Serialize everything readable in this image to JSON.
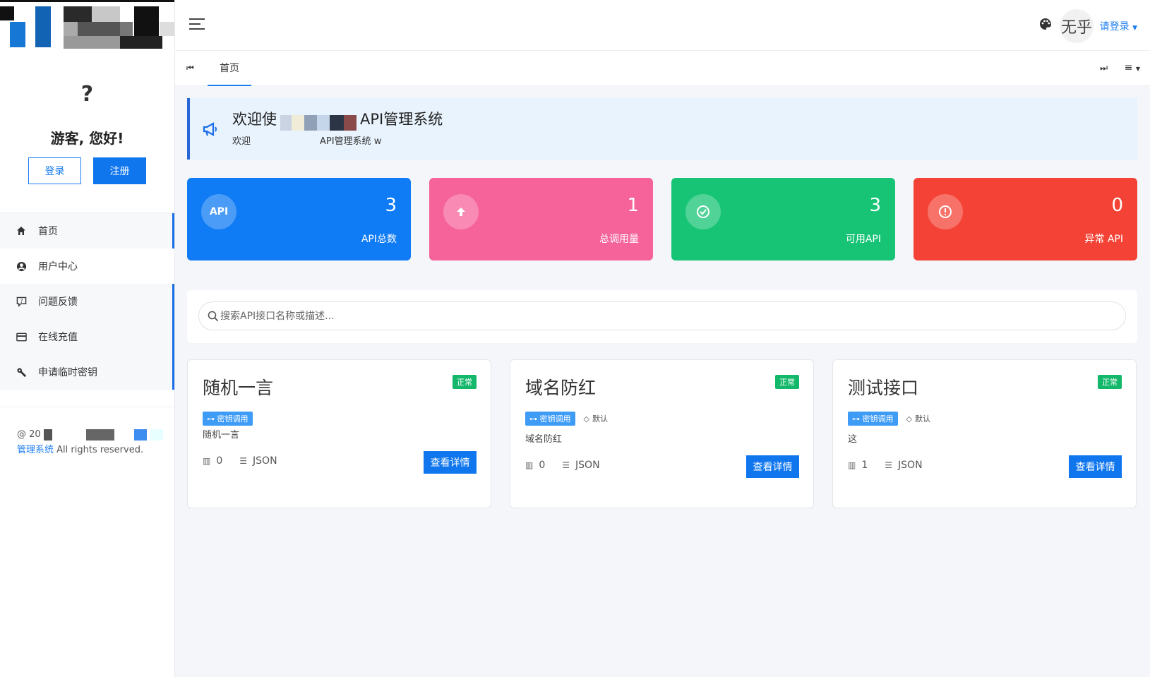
{
  "sidebar": {
    "avatar_placeholder": "?",
    "greeting": "游客, 您好!",
    "login_label": "登录",
    "register_label": "注册",
    "items": [
      {
        "label": "首页",
        "icon": "home-icon"
      },
      {
        "label": "用户中心",
        "icon": "user-circle-icon"
      },
      {
        "label": "问题反馈",
        "icon": "feedback-icon"
      },
      {
        "label": "在线充值",
        "icon": "credit-card-icon"
      },
      {
        "label": "申请临时密钥",
        "icon": "wrench-icon"
      }
    ],
    "footer_prefix": "@ 20",
    "footer_link": "管理系统",
    "footer_suffix": " All rights reserved."
  },
  "header": {
    "avatar_text": "无乎",
    "login_link": "请登录"
  },
  "tabs": {
    "home": "首页"
  },
  "welcome": {
    "title_start": "欢迎使",
    "title_end": "API管理系统",
    "subtitle_start": "欢迎",
    "subtitle_end": "API管理系统 w"
  },
  "stats": [
    {
      "icon_text": "API",
      "value": "3",
      "label": "API总数",
      "color": "#0f7bf5"
    },
    {
      "icon_text": "",
      "value": "1",
      "label": "总调用量",
      "color": "#f6639b"
    },
    {
      "icon_text": "",
      "value": "3",
      "label": "可用API",
      "color": "#17c476"
    },
    {
      "icon_text": "",
      "value": "0",
      "label": "异常 API",
      "color": "#f44336"
    }
  ],
  "search": {
    "placeholder": "搜索API接口名称或描述..."
  },
  "cards": [
    {
      "title": "随机一言",
      "status": "正常",
      "tag_key": "密钥调用",
      "tag_default": "",
      "desc": "随机一言",
      "calls": "0",
      "format": "JSON",
      "button": "查看详情"
    },
    {
      "title": "域名防红",
      "status": "正常",
      "tag_key": "密钥调用",
      "tag_default": "默认",
      "desc": "域名防红",
      "calls": "0",
      "format": "JSON",
      "button": "查看详情"
    },
    {
      "title": "测试接口",
      "status": "正常",
      "tag_key": "密钥调用",
      "tag_default": "默认",
      "desc": "这",
      "calls": "1",
      "format": "JSON",
      "button": "查看详情"
    }
  ]
}
